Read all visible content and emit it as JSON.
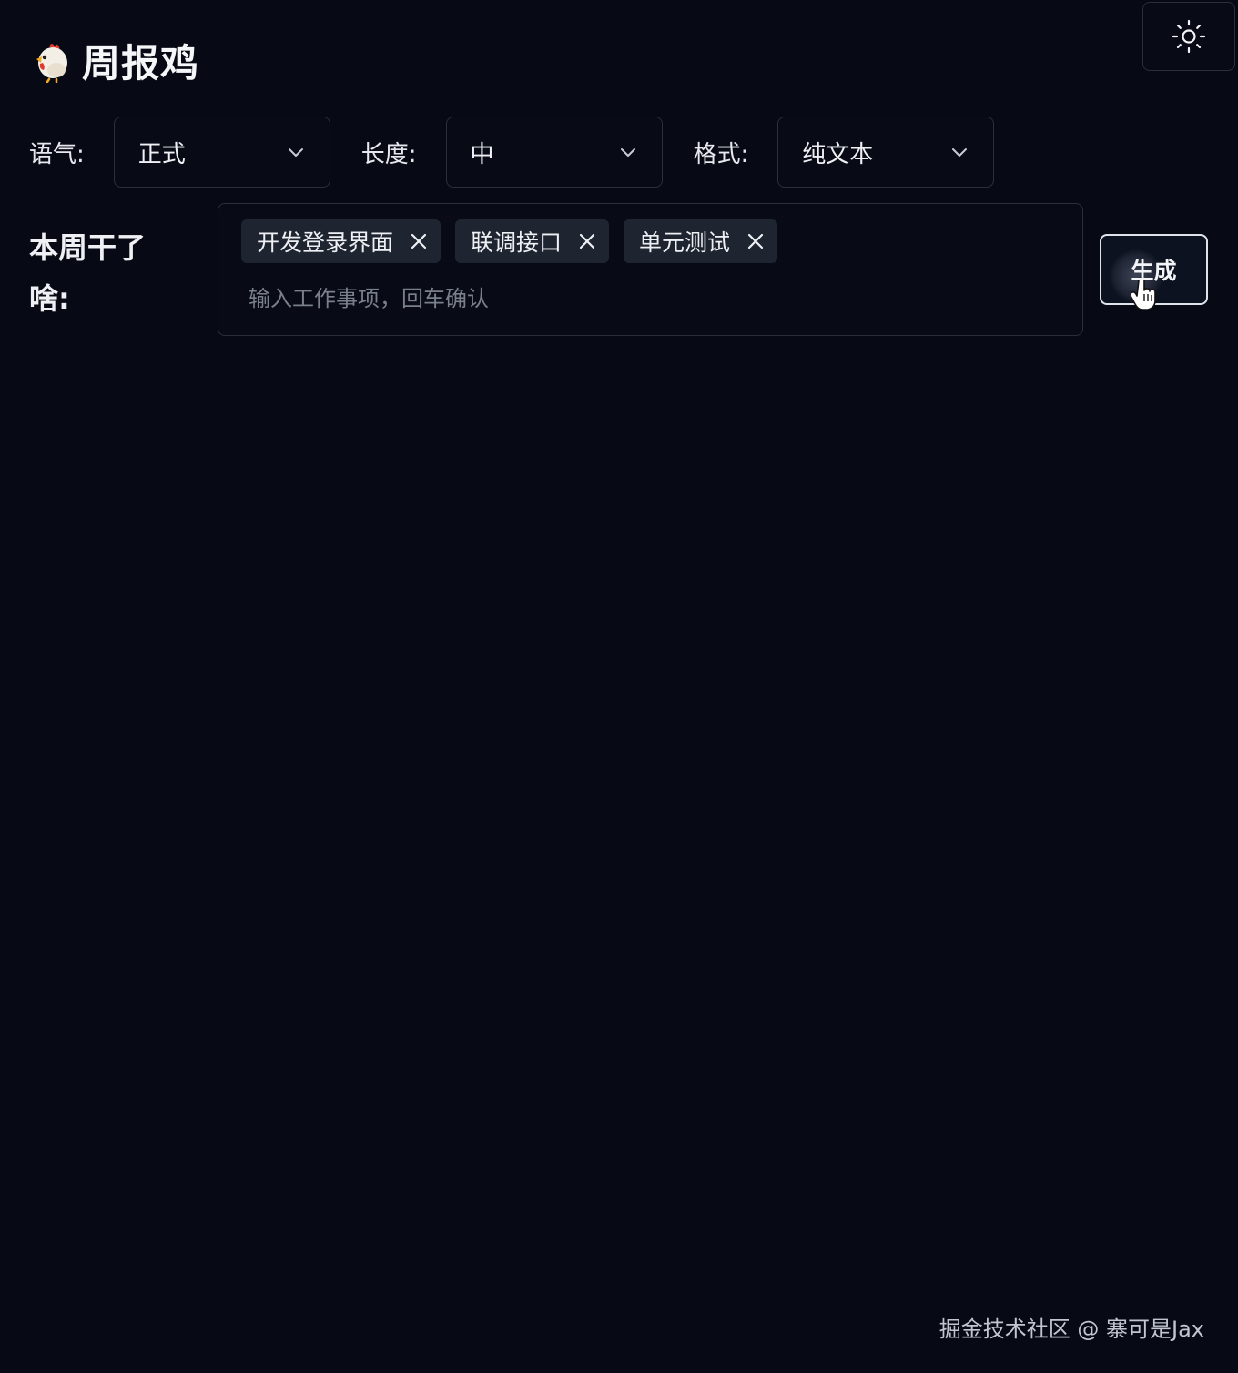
{
  "header": {
    "logo_icon": "chicken-icon",
    "title": "周报鸡",
    "theme_toggle_icon": "sun-icon"
  },
  "options": {
    "tone": {
      "label": "语气:",
      "value": "正式"
    },
    "length": {
      "label": "长度:",
      "value": "中"
    },
    "format": {
      "label": "格式:",
      "value": "纯文本"
    }
  },
  "tasks": {
    "label": "本周干了啥:",
    "tags": [
      "开发登录界面",
      "联调接口",
      "单元测试"
    ],
    "input_placeholder": "输入工作事项，回车确认",
    "input_value": ""
  },
  "generate_button": {
    "label": "生成"
  },
  "watermark": "掘金技术社区 @ 寨可是Jax",
  "colors": {
    "background": "#070a15",
    "border": "#2a2f3d",
    "tag_bg": "#1e2430",
    "text": "#eef0f4",
    "placeholder": "#7a7f8c"
  }
}
